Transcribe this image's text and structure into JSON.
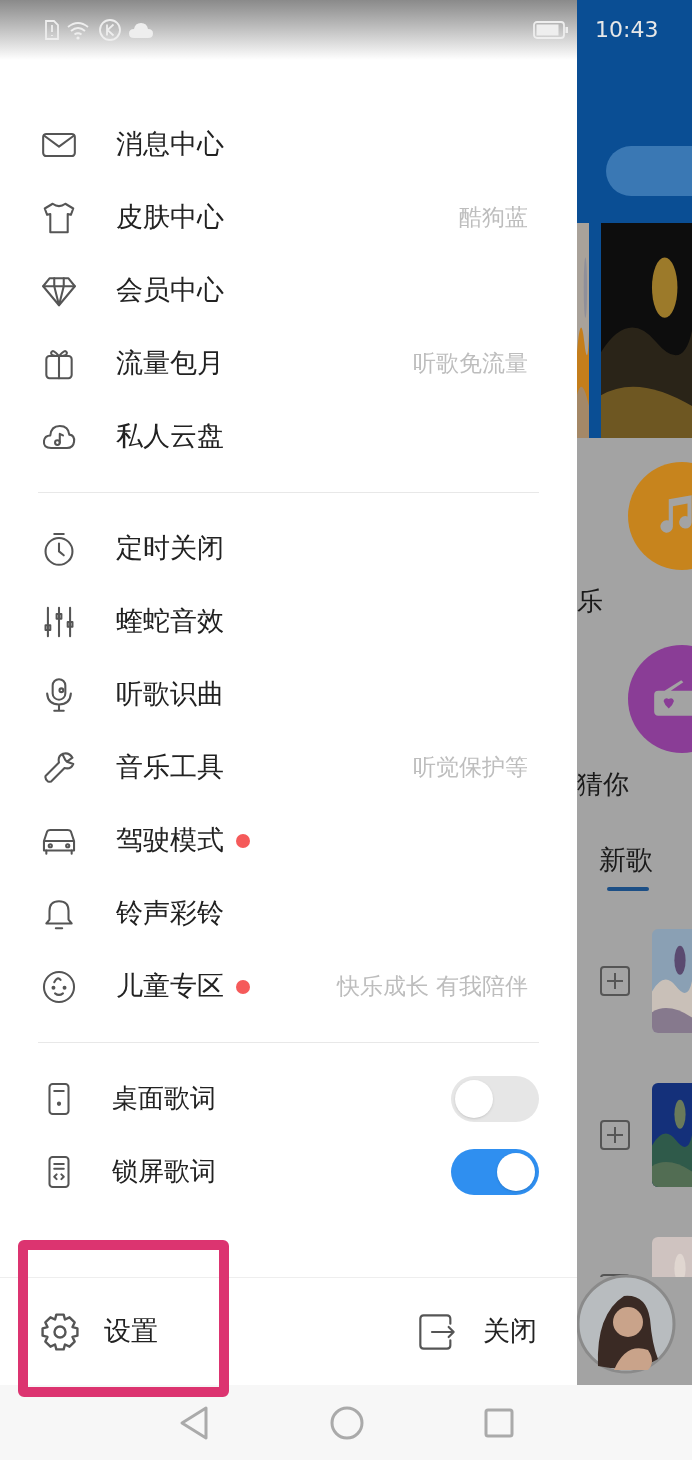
{
  "status_bar": {
    "time": "10:43"
  },
  "menu_groups": [
    [
      {
        "label": "消息中心",
        "dot": false
      },
      {
        "label": "皮肤中心",
        "hint": "酷狗蓝",
        "dot": false
      },
      {
        "label": "会员中心",
        "dot": false
      },
      {
        "label": "流量包月",
        "hint": "听歌免流量",
        "dot": false
      },
      {
        "label": "私人云盘",
        "dot": false
      }
    ],
    [
      {
        "label": "定时关闭",
        "dot": false
      },
      {
        "label": "蝰蛇音效",
        "dot": false
      },
      {
        "label": "听歌识曲",
        "dot": false
      },
      {
        "label": "音乐工具",
        "hint": "听觉保护等",
        "dot": false
      },
      {
        "label": "驾驶模式",
        "dot": true
      },
      {
        "label": "铃声彩铃",
        "dot": false
      },
      {
        "label": "儿童专区",
        "hint": "快乐成长 有我陪伴",
        "dot": true
      }
    ]
  ],
  "toggles": [
    {
      "label": "桌面歌词",
      "on": false
    },
    {
      "label": "锁屏歌词",
      "on": true
    }
  ],
  "footer": {
    "settings": "设置",
    "close": "关闭"
  },
  "background": {
    "tiles": [
      "乐",
      "猜你"
    ],
    "section_tab": "新歌"
  }
}
